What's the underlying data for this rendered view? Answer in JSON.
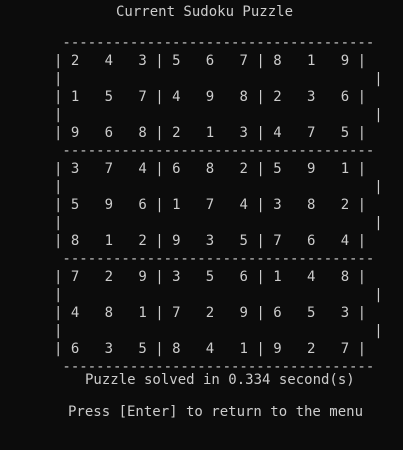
{
  "window": {
    "title": "Current Sudoku Puzzle"
  },
  "board": {
    "rows": [
      [
        "2",
        "4",
        "3",
        "5",
        "6",
        "7",
        "8",
        "1",
        "9"
      ],
      [
        "1",
        "5",
        "7",
        "4",
        "9",
        "8",
        "2",
        "3",
        "6"
      ],
      [
        "9",
        "6",
        "8",
        "2",
        "1",
        "3",
        "4",
        "7",
        "5"
      ],
      [
        "3",
        "7",
        "4",
        "6",
        "8",
        "2",
        "5",
        "9",
        "1"
      ],
      [
        "5",
        "9",
        "6",
        "1",
        "7",
        "4",
        "3",
        "8",
        "2"
      ],
      [
        "8",
        "1",
        "2",
        "9",
        "3",
        "5",
        "7",
        "6",
        "4"
      ],
      [
        "7",
        "2",
        "9",
        "3",
        "5",
        "6",
        "1",
        "4",
        "8"
      ],
      [
        "4",
        "8",
        "1",
        "7",
        "2",
        "9",
        "6",
        "5",
        "3"
      ],
      [
        "6",
        "3",
        "5",
        "8",
        "4",
        "1",
        "9",
        "2",
        "7"
      ]
    ]
  },
  "status": {
    "message": "Puzzle solved in 0.334 second(s)"
  },
  "prompt": {
    "message": "Press [Enter] to return to the menu"
  },
  "colors": {
    "background": "#0c0c0c",
    "foreground": "#cccccc"
  }
}
